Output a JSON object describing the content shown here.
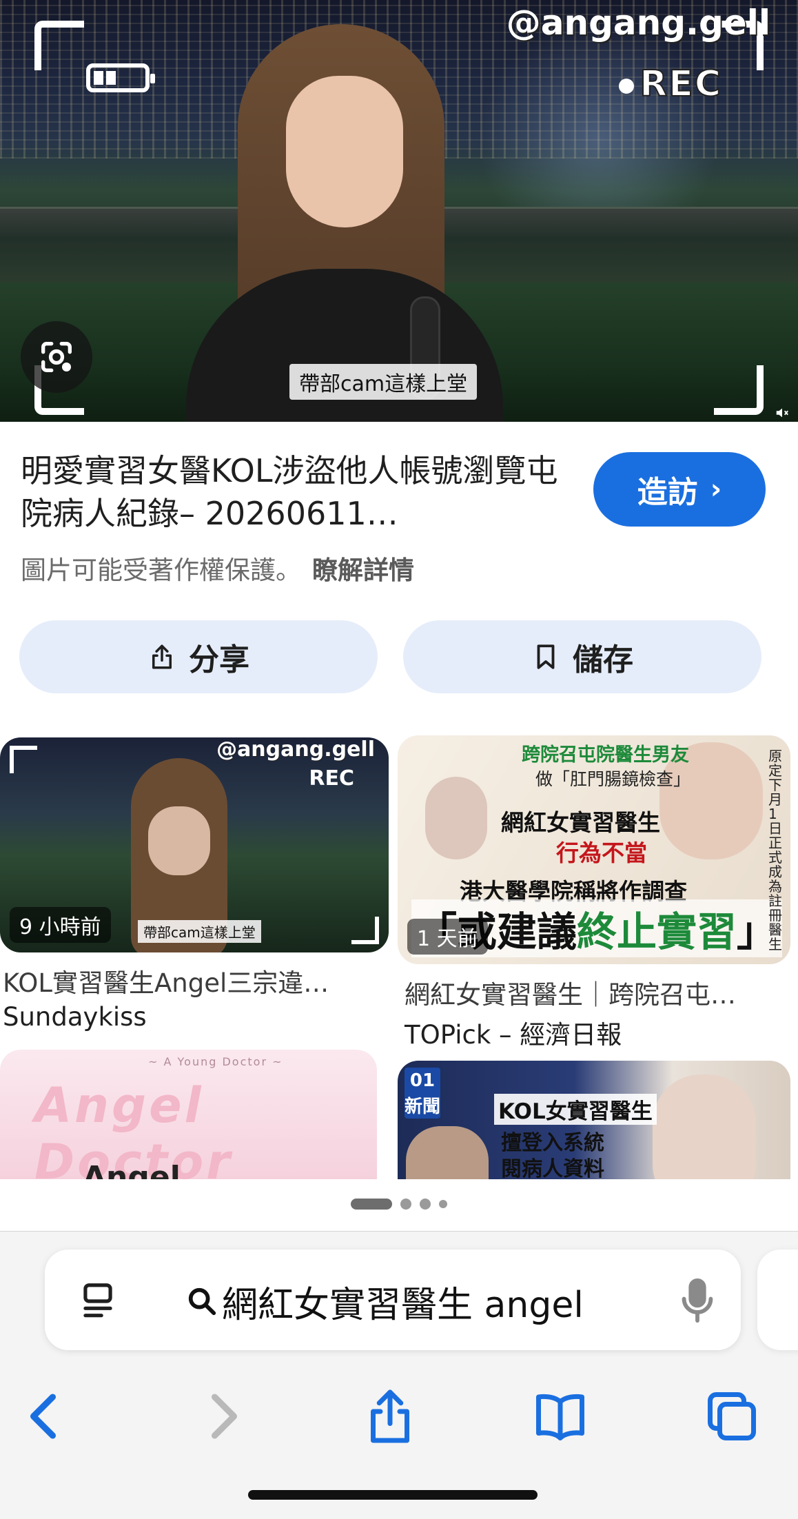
{
  "hero": {
    "watermark": "@angang.gell",
    "rec_label": "REC",
    "caption": "帶部cam這樣上堂"
  },
  "result": {
    "title": "明愛實習女醫KOL涉盜他人帳號瀏覽屯院病人紀錄– 20260611…",
    "visit_label": "造訪",
    "copyright_notice": "圖片可能受著作權保護。",
    "learn_more": "瞭解詳情",
    "share_label": "分享",
    "save_label": "儲存"
  },
  "related": [
    {
      "time": "9 小時前",
      "title": "KOL實習醫生Angel三宗違…",
      "source": "Sundaykiss",
      "thumb": {
        "watermark": "@angang.gell",
        "rec": "REC",
        "caption": "帶部cam這樣上堂"
      }
    },
    {
      "time": "1 天前",
      "title": "網紅女實習醫生｜跨院召屯…",
      "source": "TOPick – 經濟日報",
      "thumb": {
        "headline1": "跨院召屯院醫生男友",
        "headline2": "做「肛門腸鏡檢查」",
        "main": "網紅女實習醫生",
        "red": "行為不當",
        "mid": "港大醫學院稱將作調查",
        "big_prefix": "「或建議",
        "big_green": "終止實習",
        "big_suffix": "」",
        "side": "原定下月1日正式成為註冊醫生"
      }
    },
    {
      "thumb": {
        "tiny": "~ A Young Doctor ~",
        "title": "Angel Doctor",
        "name": "Angel"
      }
    },
    {
      "thumb": {
        "logo": "01 新聞",
        "h1": "KOL女實習醫生",
        "h2": "擅登入系統",
        "h3": "閱病人資料"
      }
    }
  ],
  "browser": {
    "search_query": "網紅女實習醫生 angel"
  },
  "colors": {
    "accent": "#1a6fe0",
    "button_bg": "#e6edfa",
    "chrome_bg": "#f4f4f4"
  },
  "icons": {
    "lens": "google-lens-icon",
    "share": "share-icon",
    "bookmark": "bookmark-icon",
    "reader": "reader-mode-icon",
    "search": "search-icon",
    "mic": "microphone-icon",
    "back": "chevron-left-icon",
    "forward": "chevron-right-icon",
    "toolbar_share": "share-icon",
    "bookmarks": "open-book-icon",
    "tabs": "tabs-icon"
  }
}
